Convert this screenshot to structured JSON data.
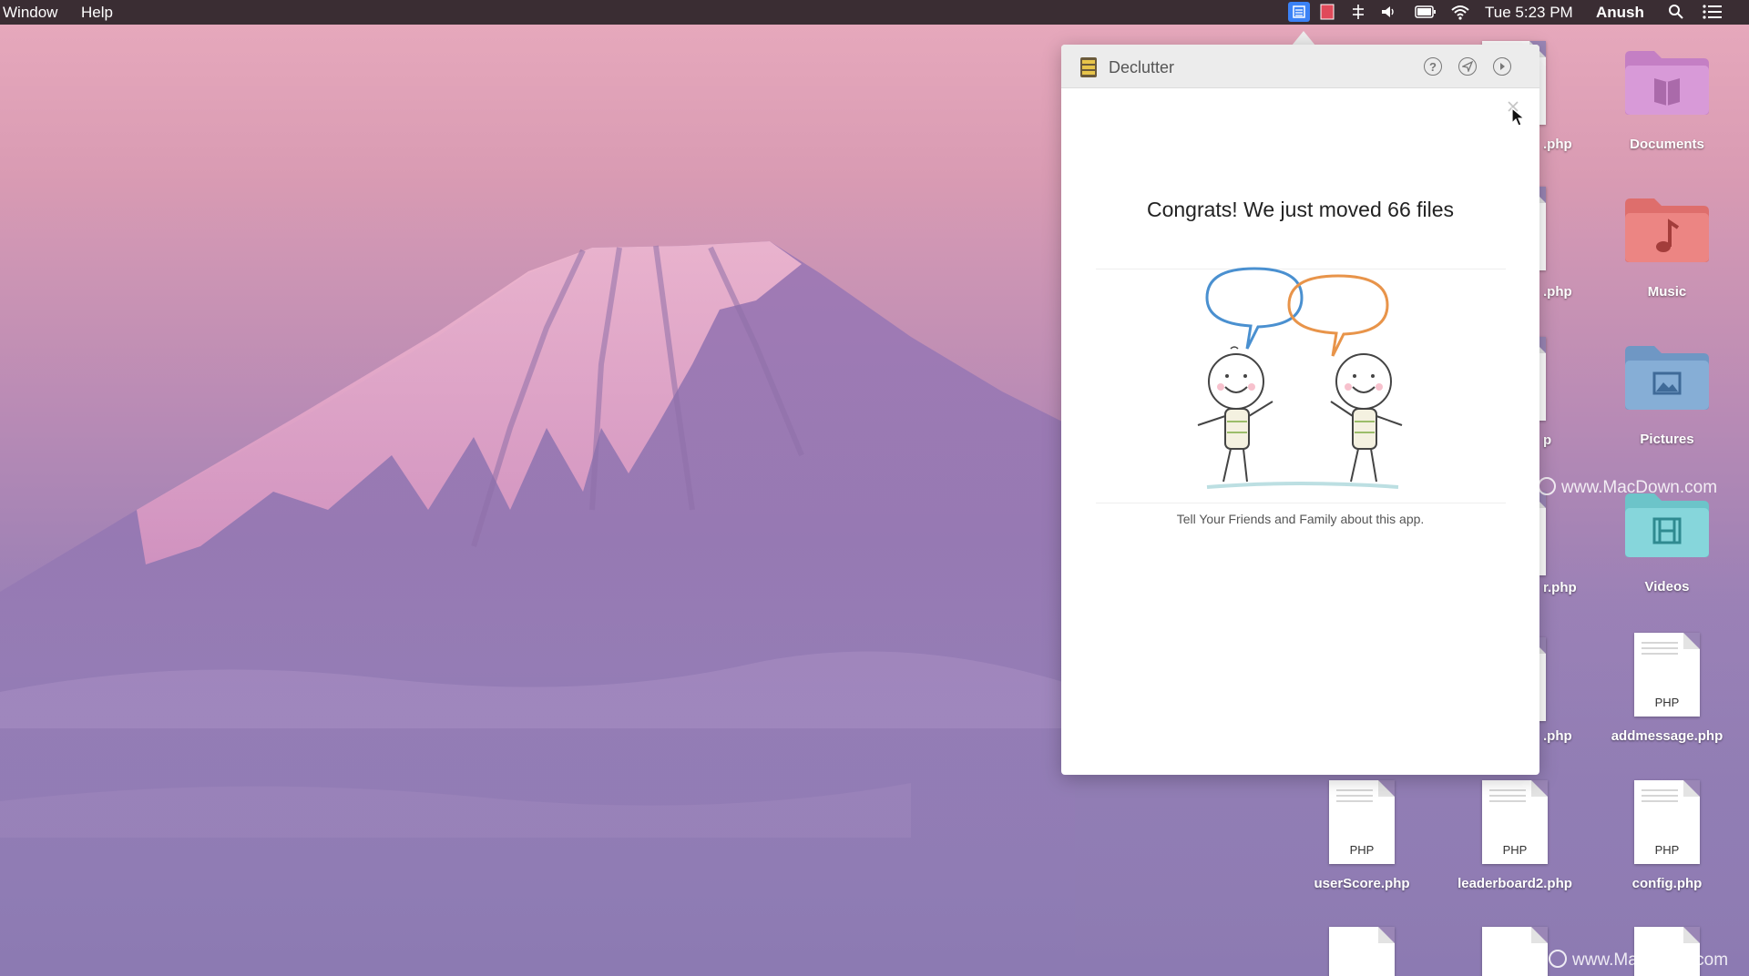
{
  "menubar": {
    "window_label": "Window",
    "help_label": "Help",
    "clock": "Tue 5:23 PM",
    "user": "Anush"
  },
  "popover": {
    "app_title": "Declutter",
    "congrats_text": "Congrats! We just moved 66 files",
    "tell_text": "Tell Your Friends and Family about this app."
  },
  "desktop": {
    "folders": [
      {
        "label": "Documents",
        "color": "#d59bd4",
        "icon": "book-icon"
      },
      {
        "label": "Music",
        "color": "#e8807e",
        "icon": "music-note-icon"
      },
      {
        "label": "Pictures",
        "color": "#7fa6d0",
        "icon": "picture-icon"
      },
      {
        "label": "Videos",
        "color": "#7fd0d5",
        "icon": "film-icon"
      }
    ],
    "files": [
      {
        "label": "addmessage.php",
        "ext": "PHP"
      },
      {
        "label": "userScore.php",
        "ext": "PHP"
      },
      {
        "label": "leaderboard2.php",
        "ext": "PHP"
      },
      {
        "label": "config.php",
        "ext": "PHP"
      }
    ],
    "partial_labels": [
      ".php",
      ".php",
      "p",
      "r.php",
      ".php"
    ]
  },
  "watermark_text": "www.MacDown.com",
  "colors": {
    "menubar_bg": "#3a2d33",
    "highlight_icon": "#3b82f6"
  }
}
